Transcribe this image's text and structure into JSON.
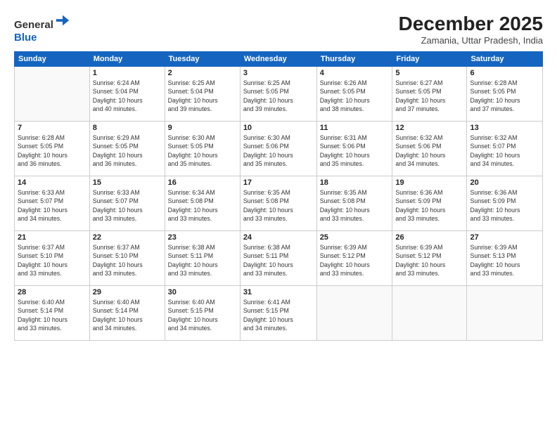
{
  "logo": {
    "line1": "General",
    "line2": "Blue"
  },
  "title": "December 2025",
  "location": "Zamania, Uttar Pradesh, India",
  "weekdays": [
    "Sunday",
    "Monday",
    "Tuesday",
    "Wednesday",
    "Thursday",
    "Friday",
    "Saturday"
  ],
  "weeks": [
    [
      {
        "day": "",
        "info": ""
      },
      {
        "day": "1",
        "info": "Sunrise: 6:24 AM\nSunset: 5:04 PM\nDaylight: 10 hours\nand 40 minutes."
      },
      {
        "day": "2",
        "info": "Sunrise: 6:25 AM\nSunset: 5:04 PM\nDaylight: 10 hours\nand 39 minutes."
      },
      {
        "day": "3",
        "info": "Sunrise: 6:25 AM\nSunset: 5:05 PM\nDaylight: 10 hours\nand 39 minutes."
      },
      {
        "day": "4",
        "info": "Sunrise: 6:26 AM\nSunset: 5:05 PM\nDaylight: 10 hours\nand 38 minutes."
      },
      {
        "day": "5",
        "info": "Sunrise: 6:27 AM\nSunset: 5:05 PM\nDaylight: 10 hours\nand 37 minutes."
      },
      {
        "day": "6",
        "info": "Sunrise: 6:28 AM\nSunset: 5:05 PM\nDaylight: 10 hours\nand 37 minutes."
      }
    ],
    [
      {
        "day": "7",
        "info": "Sunrise: 6:28 AM\nSunset: 5:05 PM\nDaylight: 10 hours\nand 36 minutes."
      },
      {
        "day": "8",
        "info": "Sunrise: 6:29 AM\nSunset: 5:05 PM\nDaylight: 10 hours\nand 36 minutes."
      },
      {
        "day": "9",
        "info": "Sunrise: 6:30 AM\nSunset: 5:05 PM\nDaylight: 10 hours\nand 35 minutes."
      },
      {
        "day": "10",
        "info": "Sunrise: 6:30 AM\nSunset: 5:06 PM\nDaylight: 10 hours\nand 35 minutes."
      },
      {
        "day": "11",
        "info": "Sunrise: 6:31 AM\nSunset: 5:06 PM\nDaylight: 10 hours\nand 35 minutes."
      },
      {
        "day": "12",
        "info": "Sunrise: 6:32 AM\nSunset: 5:06 PM\nDaylight: 10 hours\nand 34 minutes."
      },
      {
        "day": "13",
        "info": "Sunrise: 6:32 AM\nSunset: 5:07 PM\nDaylight: 10 hours\nand 34 minutes."
      }
    ],
    [
      {
        "day": "14",
        "info": "Sunrise: 6:33 AM\nSunset: 5:07 PM\nDaylight: 10 hours\nand 34 minutes."
      },
      {
        "day": "15",
        "info": "Sunrise: 6:33 AM\nSunset: 5:07 PM\nDaylight: 10 hours\nand 33 minutes."
      },
      {
        "day": "16",
        "info": "Sunrise: 6:34 AM\nSunset: 5:08 PM\nDaylight: 10 hours\nand 33 minutes."
      },
      {
        "day": "17",
        "info": "Sunrise: 6:35 AM\nSunset: 5:08 PM\nDaylight: 10 hours\nand 33 minutes."
      },
      {
        "day": "18",
        "info": "Sunrise: 6:35 AM\nSunset: 5:08 PM\nDaylight: 10 hours\nand 33 minutes."
      },
      {
        "day": "19",
        "info": "Sunrise: 6:36 AM\nSunset: 5:09 PM\nDaylight: 10 hours\nand 33 minutes."
      },
      {
        "day": "20",
        "info": "Sunrise: 6:36 AM\nSunset: 5:09 PM\nDaylight: 10 hours\nand 33 minutes."
      }
    ],
    [
      {
        "day": "21",
        "info": "Sunrise: 6:37 AM\nSunset: 5:10 PM\nDaylight: 10 hours\nand 33 minutes."
      },
      {
        "day": "22",
        "info": "Sunrise: 6:37 AM\nSunset: 5:10 PM\nDaylight: 10 hours\nand 33 minutes."
      },
      {
        "day": "23",
        "info": "Sunrise: 6:38 AM\nSunset: 5:11 PM\nDaylight: 10 hours\nand 33 minutes."
      },
      {
        "day": "24",
        "info": "Sunrise: 6:38 AM\nSunset: 5:11 PM\nDaylight: 10 hours\nand 33 minutes."
      },
      {
        "day": "25",
        "info": "Sunrise: 6:39 AM\nSunset: 5:12 PM\nDaylight: 10 hours\nand 33 minutes."
      },
      {
        "day": "26",
        "info": "Sunrise: 6:39 AM\nSunset: 5:12 PM\nDaylight: 10 hours\nand 33 minutes."
      },
      {
        "day": "27",
        "info": "Sunrise: 6:39 AM\nSunset: 5:13 PM\nDaylight: 10 hours\nand 33 minutes."
      }
    ],
    [
      {
        "day": "28",
        "info": "Sunrise: 6:40 AM\nSunset: 5:14 PM\nDaylight: 10 hours\nand 33 minutes."
      },
      {
        "day": "29",
        "info": "Sunrise: 6:40 AM\nSunset: 5:14 PM\nDaylight: 10 hours\nand 34 minutes."
      },
      {
        "day": "30",
        "info": "Sunrise: 6:40 AM\nSunset: 5:15 PM\nDaylight: 10 hours\nand 34 minutes."
      },
      {
        "day": "31",
        "info": "Sunrise: 6:41 AM\nSunset: 5:15 PM\nDaylight: 10 hours\nand 34 minutes."
      },
      {
        "day": "",
        "info": ""
      },
      {
        "day": "",
        "info": ""
      },
      {
        "day": "",
        "info": ""
      }
    ]
  ]
}
